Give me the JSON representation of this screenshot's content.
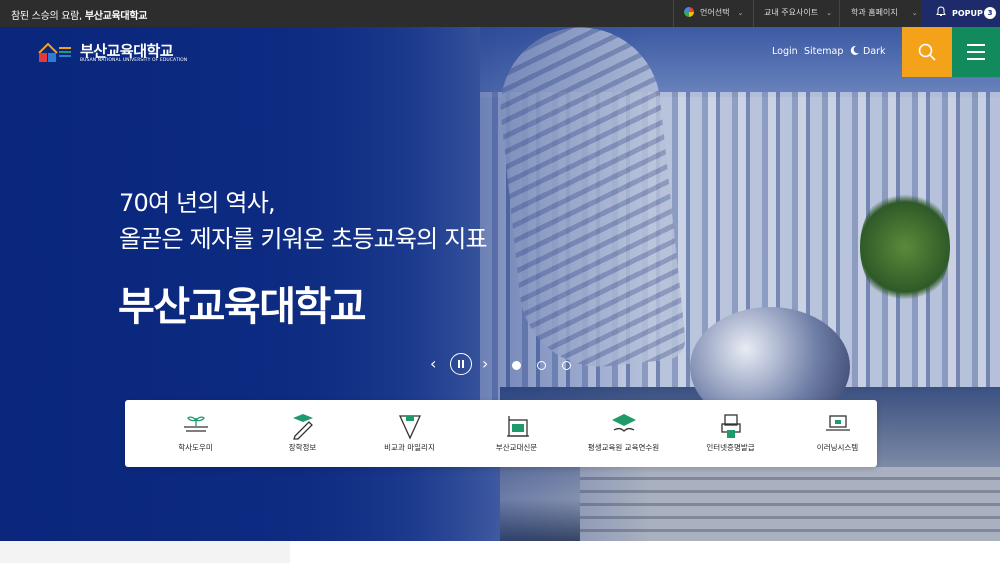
{
  "topbar": {
    "motto_prefix": "참된 스승의 요람,",
    "motto_bold": "부산교육대학교",
    "language_select": "언어선택",
    "campus_sites": "교내 주요사이트",
    "dept_homepages": "학과 홈페이지",
    "popup_label": "POPUP",
    "popup_count": "3"
  },
  "header": {
    "logo_name_ko": "부산교육대학교",
    "logo_name_en": "BUSAN NATIONAL UNIVERSITY OF EDUCATION",
    "login": "Login",
    "sitemap": "Sitemap",
    "dark": "Dark"
  },
  "hero": {
    "line1": "70여 년의 역사,",
    "line2": "올곧은 제자를 키워온 초등교육의 지표",
    "title": "부산교육대학교",
    "slide_count": 3,
    "active_slide": 1
  },
  "quick_links": [
    {
      "label": "학사도우미",
      "icon": "sprout-book-icon"
    },
    {
      "label": "장학정보",
      "icon": "graduation-pencil-icon"
    },
    {
      "label": "비교과 마일리지",
      "icon": "pencil-tip-icon"
    },
    {
      "label": "부산교대신문",
      "icon": "newspaper-icon"
    },
    {
      "label": "평생교육원 교육연수원",
      "icon": "grad-cap-book-icon"
    },
    {
      "label": "인터넷증명발급",
      "icon": "certificate-printer-icon"
    },
    {
      "label": "이러닝시스템",
      "icon": "laptop-icon"
    }
  ],
  "colors": {
    "topbar": "#2d2d2d",
    "popup": "#1d2b6a",
    "search": "#f5a21b",
    "menu": "#138a5c",
    "hero_blue": "#0c2a80",
    "icon_green": "#1f9a6a"
  }
}
